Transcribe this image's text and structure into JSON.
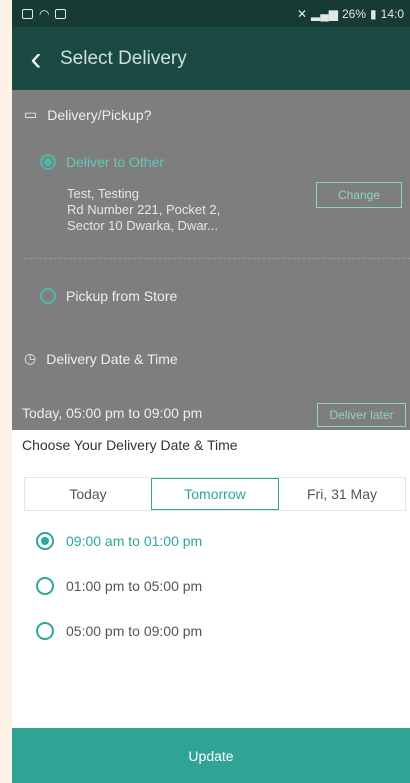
{
  "status_bar": {
    "right_text": "26%",
    "time": "14:0"
  },
  "app_bar": {
    "title": "Select Delivery"
  },
  "delivery": {
    "section_label": "Delivery/Pickup?",
    "option_deliver": "Deliver to Other",
    "address": [
      "Test, Testing",
      "Rd Number 221, Pocket 2,",
      "Sector 10 Dwarka, Dwar..."
    ],
    "change_button": "Change",
    "option_pickup": "Pickup from Store"
  },
  "date_time": {
    "section_label": "Delivery Date & Time",
    "current_value": "Today, 05:00 pm to 09:00 pm",
    "deliver_later_button": "Deliver later"
  },
  "sheet": {
    "title": "Choose Your Delivery Date & Time",
    "tabs": [
      "Today",
      "Tomorrow",
      "Fri, 31 May"
    ],
    "selected_tab": "Tomorrow",
    "slots": [
      "09:00 am to 01:00 pm",
      "01:00 pm to 05:00 pm",
      "05:00 pm to 09:00 pm"
    ],
    "selected_slot": "09:00 am to 01:00 pm",
    "update_button": "Update"
  },
  "colors": {
    "accent": "#2aa896",
    "header": "#1b4a42",
    "overlay": "#7e7e7e",
    "button": "#2fa394"
  }
}
